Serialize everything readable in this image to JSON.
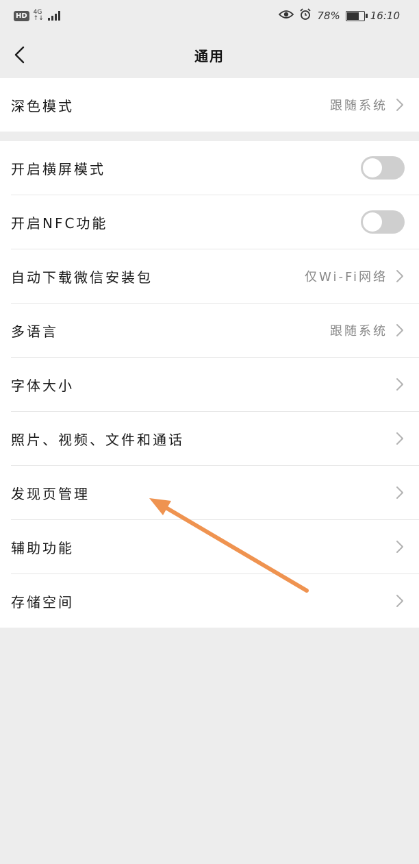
{
  "status_bar": {
    "hd": "HD",
    "network": "4G",
    "network_sub": "↑↓",
    "battery_percent": "78%",
    "battery_level": 0.78,
    "time": "16:10"
  },
  "nav": {
    "title": "通用"
  },
  "group1": {
    "items": [
      {
        "label": "深色模式",
        "value": "跟随系统"
      }
    ]
  },
  "group2": {
    "items": [
      {
        "label": "开启横屏模式",
        "toggle_on": false
      },
      {
        "label": "开启NFC功能",
        "toggle_on": false
      },
      {
        "label": "自动下载微信安装包",
        "value": "仅Wi-Fi网络"
      },
      {
        "label": "多语言",
        "value": "跟随系统"
      },
      {
        "label": "字体大小"
      },
      {
        "label": "照片、视频、文件和通话"
      },
      {
        "label": "发现页管理"
      },
      {
        "label": "辅助功能"
      },
      {
        "label": "存储空间"
      }
    ]
  },
  "colors": {
    "background": "#ededed",
    "annotation": "#ef9350"
  }
}
